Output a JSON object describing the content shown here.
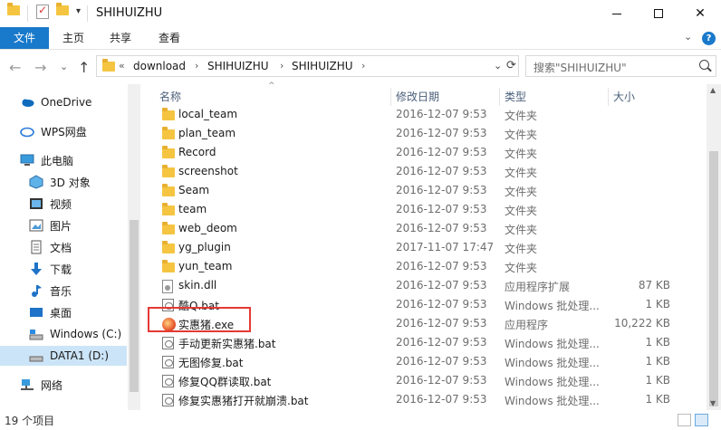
{
  "window": {
    "title": "SHIHUIZHU",
    "qa_dropdown": "▾",
    "minimize_label": "",
    "close_label": "✕"
  },
  "ribbon": {
    "tabs": [
      "文件",
      "主页",
      "共享",
      "查看"
    ],
    "collapse_label": "⌄",
    "help_label": "?"
  },
  "nav": {
    "back": "←",
    "forward": "→",
    "recent": "⌄",
    "up": "↑",
    "breadcrumb_overflow": "«",
    "breadcrumbs": [
      "download",
      "SHIHUIZHU",
      "SHIHUIZHU"
    ],
    "crumb_sep": "›",
    "address_dropdown": "⌄",
    "refresh": "⟳",
    "search_placeholder": "搜索\"SHIHUIZHU\""
  },
  "sidebar": {
    "items": [
      {
        "label": "OneDrive",
        "icon": "cloud-icon"
      },
      {
        "label": "WPS网盘",
        "icon": "wps-cloud-icon"
      },
      {
        "label": "此电脑",
        "icon": "computer-icon"
      },
      {
        "label": "3D 对象",
        "icon": "cube-icon"
      },
      {
        "label": "视频",
        "icon": "video-icon"
      },
      {
        "label": "图片",
        "icon": "picture-icon"
      },
      {
        "label": "文档",
        "icon": "document-icon"
      },
      {
        "label": "下载",
        "icon": "download-icon"
      },
      {
        "label": "音乐",
        "icon": "music-icon"
      },
      {
        "label": "桌面",
        "icon": "desktop-icon"
      },
      {
        "label": "Windows (C:)",
        "icon": "drive-icon"
      },
      {
        "label": "DATA1 (D:)",
        "icon": "drive-icon"
      },
      {
        "label": "网络",
        "icon": "network-icon"
      }
    ]
  },
  "columns": {
    "name": "名称",
    "date": "修改日期",
    "type": "类型",
    "size": "大小",
    "sort_caret": "^"
  },
  "files": [
    {
      "name": "local_team",
      "date": "2016-12-07 9:53",
      "type": "文件夹",
      "size": "",
      "kind": "folder"
    },
    {
      "name": "plan_team",
      "date": "2016-12-07 9:53",
      "type": "文件夹",
      "size": "",
      "kind": "folder"
    },
    {
      "name": "Record",
      "date": "2016-12-07 9:53",
      "type": "文件夹",
      "size": "",
      "kind": "folder"
    },
    {
      "name": "screenshot",
      "date": "2016-12-07 9:53",
      "type": "文件夹",
      "size": "",
      "kind": "folder"
    },
    {
      "name": "Seam",
      "date": "2016-12-07 9:53",
      "type": "文件夹",
      "size": "",
      "kind": "folder"
    },
    {
      "name": "team",
      "date": "2016-12-07 9:53",
      "type": "文件夹",
      "size": "",
      "kind": "folder"
    },
    {
      "name": "web_deom",
      "date": "2016-12-07 9:53",
      "type": "文件夹",
      "size": "",
      "kind": "folder"
    },
    {
      "name": "yg_plugin",
      "date": "2017-11-07 17:47",
      "type": "文件夹",
      "size": "",
      "kind": "folder"
    },
    {
      "name": "yun_team",
      "date": "2016-12-07 9:53",
      "type": "文件夹",
      "size": "",
      "kind": "folder"
    },
    {
      "name": "skin.dll",
      "date": "2016-12-07 9:53",
      "type": "应用程序扩展",
      "size": "87 KB",
      "kind": "dll"
    },
    {
      "name": "酷Q.bat",
      "date": "2016-12-07 9:53",
      "type": "Windows 批处理...",
      "size": "1 KB",
      "kind": "bat"
    },
    {
      "name": "实惠猪.exe",
      "date": "2016-12-07 9:53",
      "type": "应用程序",
      "size": "10,222 KB",
      "kind": "exe"
    },
    {
      "name": "手动更新实惠猪.bat",
      "date": "2016-12-07 9:53",
      "type": "Windows 批处理...",
      "size": "1 KB",
      "kind": "bat"
    },
    {
      "name": "无图修复.bat",
      "date": "2016-12-07 9:53",
      "type": "Windows 批处理...",
      "size": "1 KB",
      "kind": "bat"
    },
    {
      "name": "修复QQ群读取.bat",
      "date": "2016-12-07 9:53",
      "type": "Windows 批处理...",
      "size": "1 KB",
      "kind": "bat"
    },
    {
      "name": "修复实惠猪打开就崩溃.bat",
      "date": "2016-12-07 9:53",
      "type": "Windows 批处理...",
      "size": "1 KB",
      "kind": "bat"
    }
  ],
  "status": {
    "item_count": "19 个项目"
  },
  "colors": {
    "accent": "#1979ca",
    "selection": "#cce4f7",
    "highlight_border": "#e53935",
    "folder": "#f5c542"
  }
}
